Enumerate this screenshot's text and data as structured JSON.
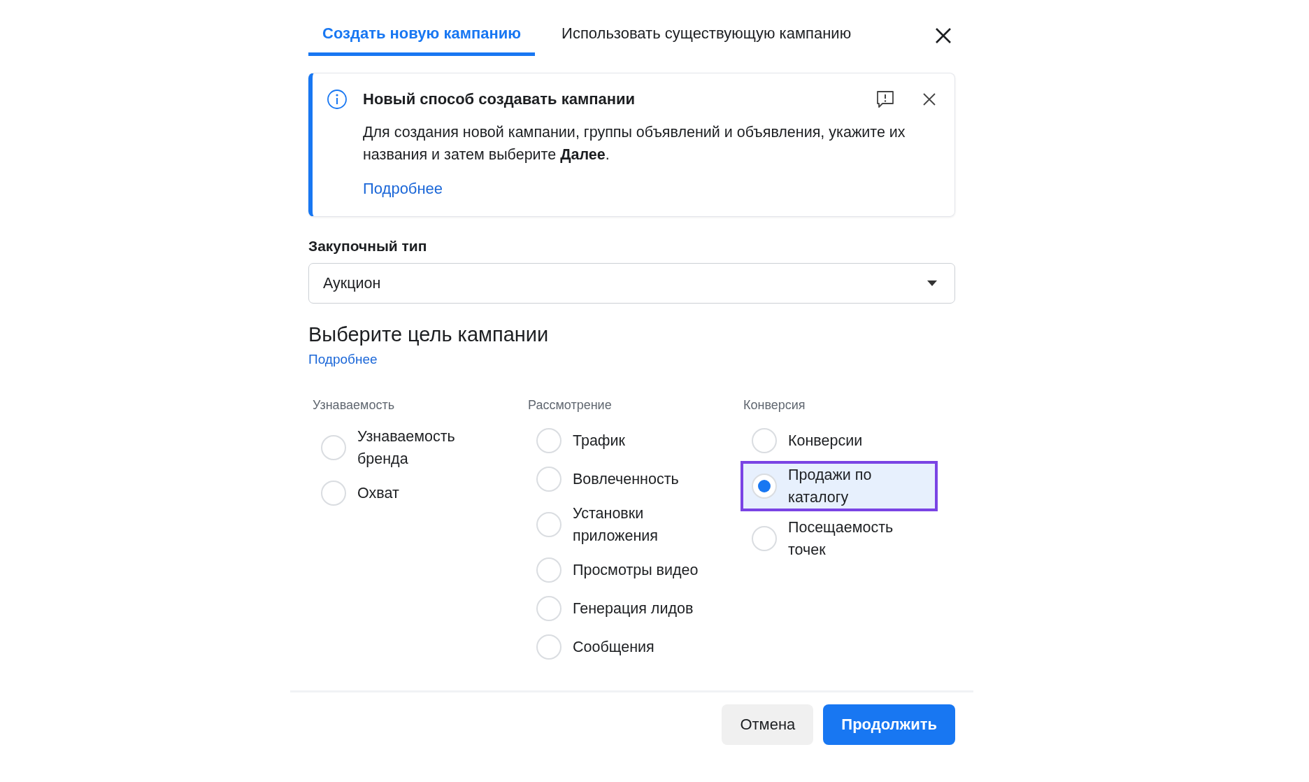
{
  "tabs": [
    {
      "label": "Создать новую кампанию",
      "selected": true
    },
    {
      "label": "Использовать существующую кампанию",
      "selected": false
    }
  ],
  "banner": {
    "title": "Новый способ создавать кампании",
    "text": "Для создания новой кампании, группы объявлений и объявления, укажите их названия и затем выберите **Далее**.",
    "link": "Подробнее"
  },
  "buying_type": {
    "label": "Закупочный тип",
    "value": "Аукцион"
  },
  "objective": {
    "heading": "Выберите цель кампании",
    "link": "Подробнее",
    "groups": [
      {
        "title": "Узнаваемость",
        "options": [
          {
            "label": "Узнаваемость бренда",
            "selected": false
          },
          {
            "label": "Охват",
            "selected": false
          }
        ]
      },
      {
        "title": "Рассмотрение",
        "options": [
          {
            "label": "Трафик",
            "selected": false
          },
          {
            "label": "Вовлеченность",
            "selected": false
          },
          {
            "label": "Установки приложения",
            "selected": false
          },
          {
            "label": "Просмотры видео",
            "selected": false
          },
          {
            "label": "Генерация лидов",
            "selected": false
          },
          {
            "label": "Сообщения",
            "selected": false
          }
        ]
      },
      {
        "title": "Конверсия",
        "options": [
          {
            "label": "Конверсии",
            "selected": false
          },
          {
            "label": "Продажи по каталогу",
            "selected": true
          },
          {
            "label": "Посещаемость точек",
            "selected": false
          }
        ]
      }
    ]
  },
  "buttons": [
    {
      "label": "Отмена",
      "kind": "secondary"
    },
    {
      "label": "Продолжить",
      "kind": "primary"
    }
  ]
}
